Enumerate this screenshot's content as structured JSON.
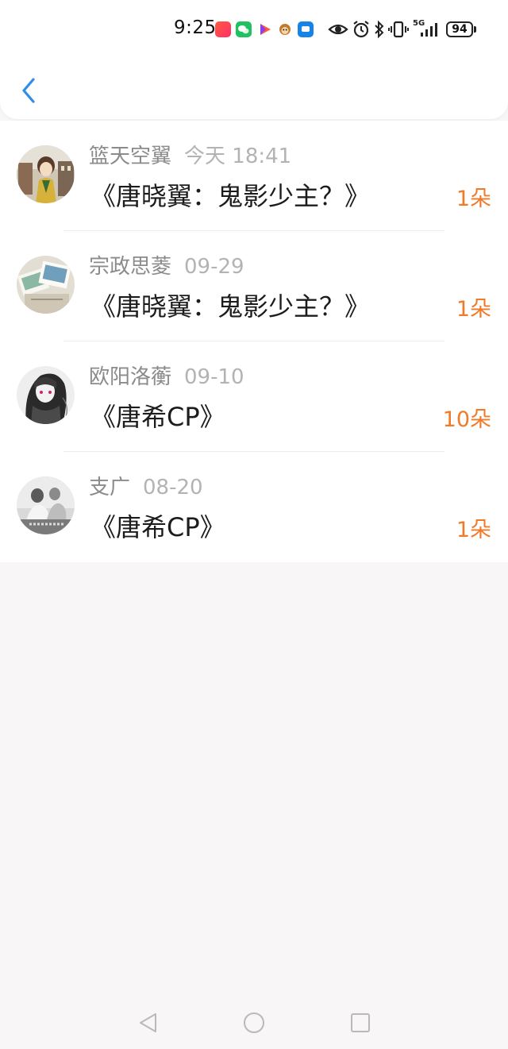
{
  "status_bar": {
    "time": "9:25",
    "battery": "94",
    "network": "5G"
  },
  "header": {
    "back_icon": "chevron-left-icon"
  },
  "gifts": [
    {
      "sender": "篮天空翼",
      "date": "今天 18:41",
      "title": "《唐晓翼：鬼影少主？》",
      "count": "1朵"
    },
    {
      "sender": "宗政思菱",
      "date": "09-29",
      "title": "《唐晓翼：鬼影少主？》",
      "count": "1朵"
    },
    {
      "sender": "欧阳洛蘅",
      "date": "09-10",
      "title": "《唐希CP》",
      "count": "10朵"
    },
    {
      "sender": "支广",
      "date": "08-20",
      "title": "《唐希CP》",
      "count": "1朵"
    }
  ],
  "nav_bar": {
    "back": "triangle-back-icon",
    "home": "circle-home-icon",
    "recents": "square-recents-icon"
  },
  "colors": {
    "accent_blue": "#2f8fe8",
    "count_orange": "#f07a28",
    "background": "#f8f6f7"
  }
}
